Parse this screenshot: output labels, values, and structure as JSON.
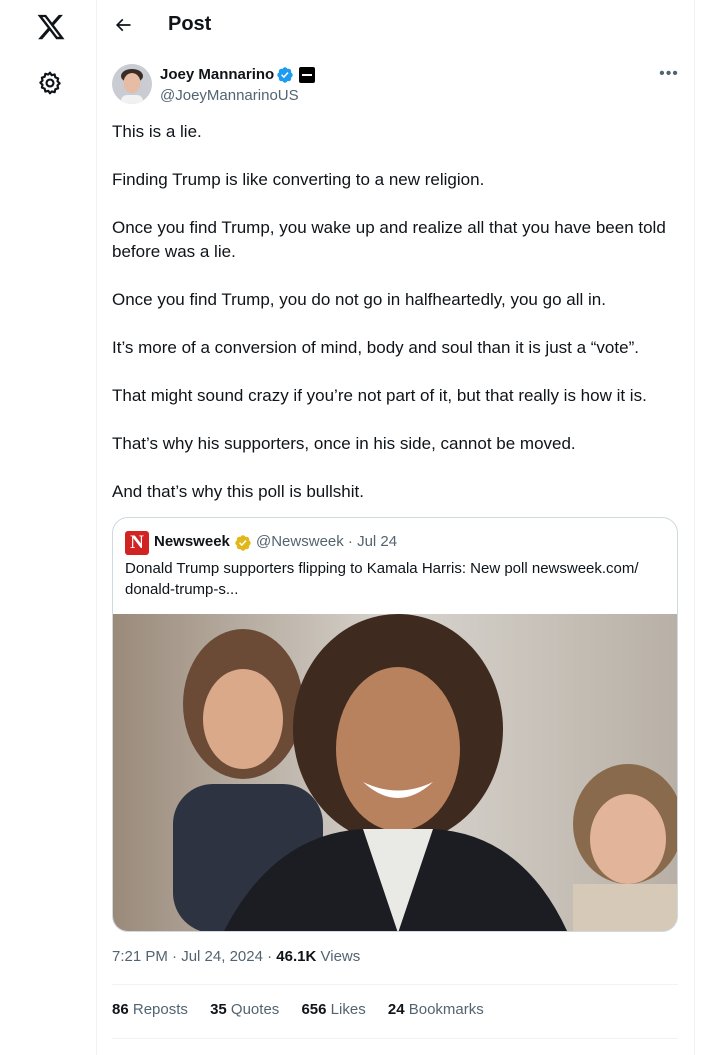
{
  "header": {
    "title": "Post"
  },
  "author": {
    "name": "Joey Mannarino",
    "handle": "@JoeyMannarinoUS"
  },
  "post": {
    "paragraphs": [
      "This is a lie.",
      "Finding Trump is like converting to a new religion.",
      "Once you find Trump, you wake up and realize all that you have been told before was a lie.",
      "Once you find Trump, you do not go in halfheartedly, you go all in.",
      "It’s more of a conversion of mind, body and soul than it is just a “vote”.",
      "That might sound crazy if you’re not part of it, but that really is how it is.",
      "That’s why his supporters, once in his side, cannot be moved.",
      "And that’s why this poll is bullshit."
    ],
    "time": "7:21 PM",
    "date": "Jul 24, 2024",
    "views_count": "46.1K",
    "views_label": "Views"
  },
  "quote": {
    "logo_letter": "N",
    "name": "Newsweek",
    "meta": "@Newsweek · Jul 24",
    "text": "Donald Trump supporters flipping to Kamala Harris: New poll newsweek.com/ donald-trump-s..."
  },
  "stats": {
    "reposts_count": "86",
    "reposts_label": "Reposts",
    "quotes_count": "35",
    "quotes_label": "Quotes",
    "likes_count": "656",
    "likes_label": "Likes",
    "bookmarks_count": "24",
    "bookmarks_label": "Bookmarks"
  },
  "colors": {
    "verified_blue": "#1d9bf0",
    "verified_gold": "#e2b719",
    "secondary_text": "#536471",
    "newsweek_red": "#d22323"
  }
}
